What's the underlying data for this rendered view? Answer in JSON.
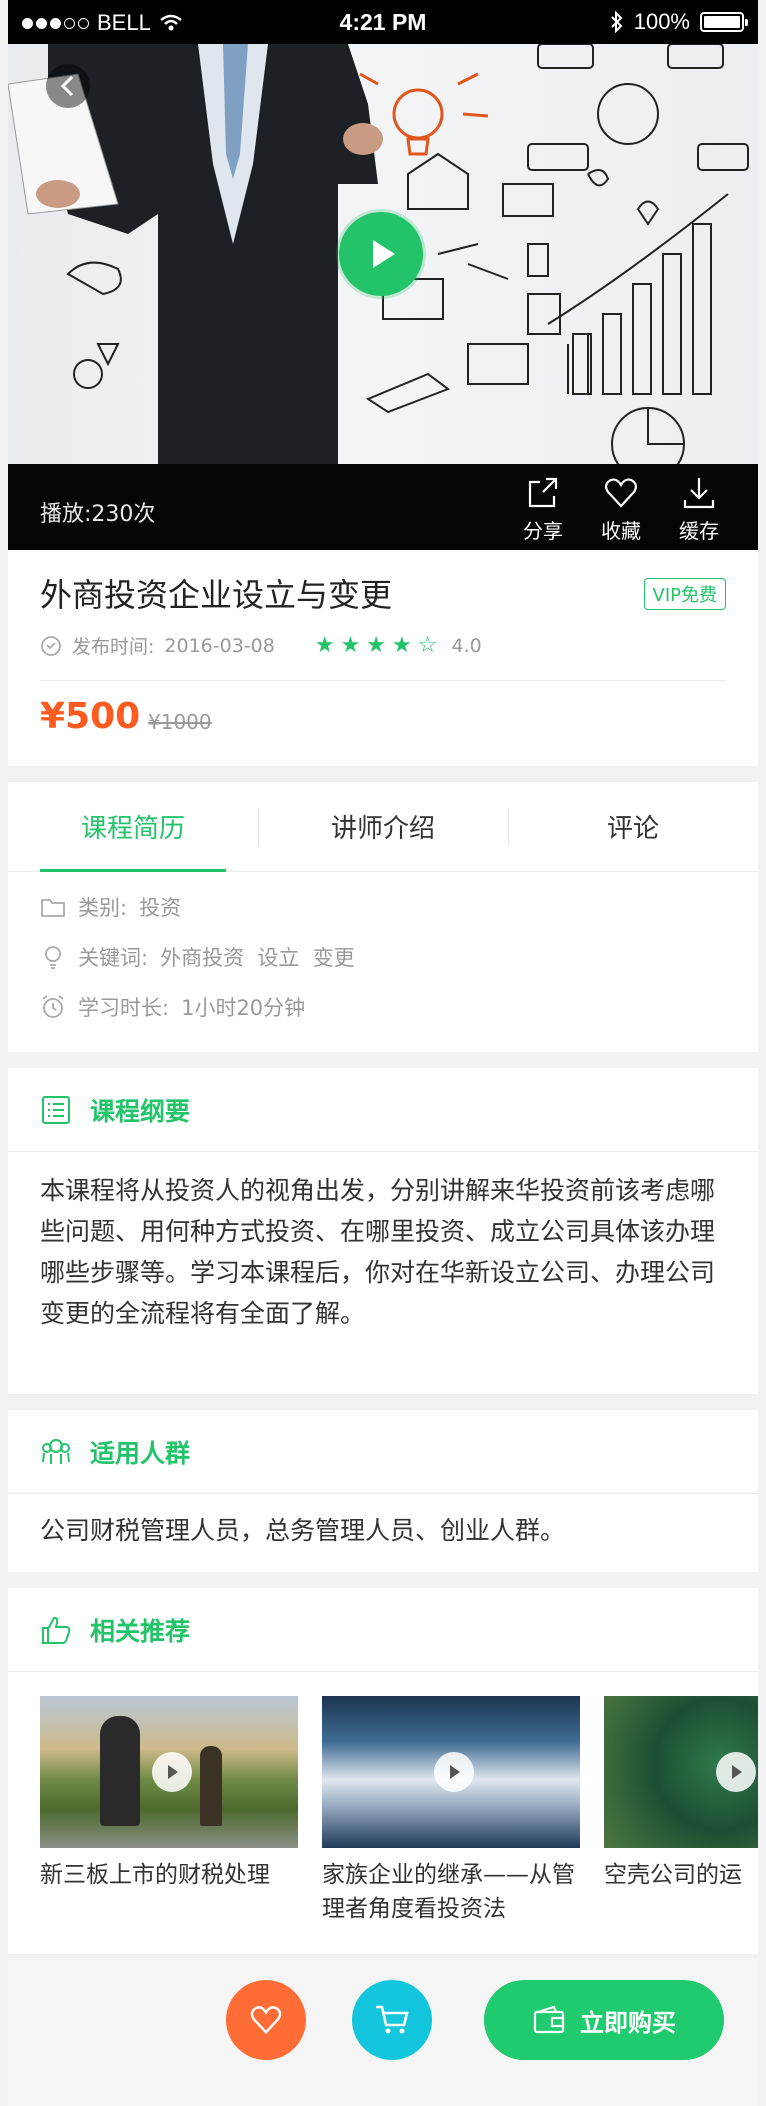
{
  "status_bar": {
    "carrier": "BELL",
    "time": "4:21 PM",
    "battery": "100%"
  },
  "video": {
    "plays_label": "播放:230次",
    "share": "分享",
    "favorite": "收藏",
    "cache": "缓存"
  },
  "course": {
    "title": "外商投资企业设立与变更",
    "vip_badge": "VIP免费",
    "publish_label": "发布时间:",
    "publish_date": "2016-03-08",
    "rating": "4.0",
    "rating_value": 4.0,
    "price": "¥500",
    "original_price": "¥1000"
  },
  "tabs": [
    "课程简历",
    "讲师介绍",
    "评论"
  ],
  "info": {
    "category_label": "类别:",
    "category": "投资",
    "keywords_label": "关键词:",
    "keywords": "外商投资  设立  变更",
    "duration_label": "学习时长:",
    "duration": "1小时20分钟"
  },
  "outline": {
    "title": "课程纲要",
    "text": "本课程将从投资人的视角出发，分别讲解来华投资前该考虑哪些问题、用何种方式投资、在哪里投资、成立公司具体该办理哪些步骤等。学习本课程后，你对在华新设立公司、办理公司变更的全流程将有全面了解。"
  },
  "audience": {
    "title": "适用人群",
    "text": "公司财税管理人员，总务管理人员、创业人群。"
  },
  "recommend": {
    "title": "相关推荐",
    "items": [
      {
        "title": "新三板上市的财税处理"
      },
      {
        "title": "家族企业的继承——从管理者角度看投资法"
      },
      {
        "title": "空壳公司的运"
      }
    ]
  },
  "bottom": {
    "buy": "立即购买"
  },
  "colors": {
    "accent": "#23c36a",
    "price": "#ff5a1f",
    "fav": "#ff6c36",
    "cart": "#14c6dd"
  }
}
